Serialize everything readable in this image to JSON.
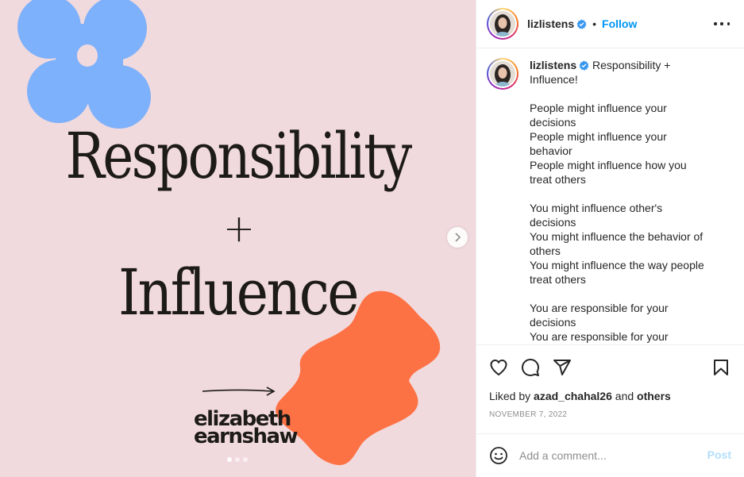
{
  "post": {
    "username": "lizlistens",
    "verified": true,
    "follow_label": "Follow",
    "more_icon": "more-horizontal-icon"
  },
  "media": {
    "headline_top": "Responsibility",
    "plus": "+",
    "headline_bottom": "Influence",
    "author_line1": "elizabeth",
    "author_line2": "earnshaw",
    "carousel_slides": 3,
    "active_slide": 1,
    "colors": {
      "background": "#f1dadd",
      "blue_shape": "#7eb1fb",
      "orange_shape": "#fd7245",
      "text": "#1d1b18"
    }
  },
  "caption": {
    "username": "lizlistens",
    "lines": [
      "Responsibility +",
      "Influence!",
      "",
      "People might influence your",
      "decisions",
      "People might influence your",
      "behavior",
      "People might influence how you",
      "treat others",
      "",
      "You might influence other's",
      "decisions",
      "You might influence the behavior of",
      "others",
      "You might influence the way people",
      "treat others",
      "",
      "You are responsible for your",
      "decisions",
      "You are responsible for your"
    ]
  },
  "actions": {
    "liked_prefix": "Liked by",
    "liked_user": "azad_chahal26",
    "liked_and": "and",
    "liked_others": "others",
    "date": "NOVEMBER 7, 2022"
  },
  "comment": {
    "placeholder": "Add a comment...",
    "post_label": "Post"
  },
  "colors": {
    "accent": "#0095f6",
    "verified": "#3897f0",
    "post_disabled": "#b2dffc",
    "muted": "#8e8e8e"
  }
}
